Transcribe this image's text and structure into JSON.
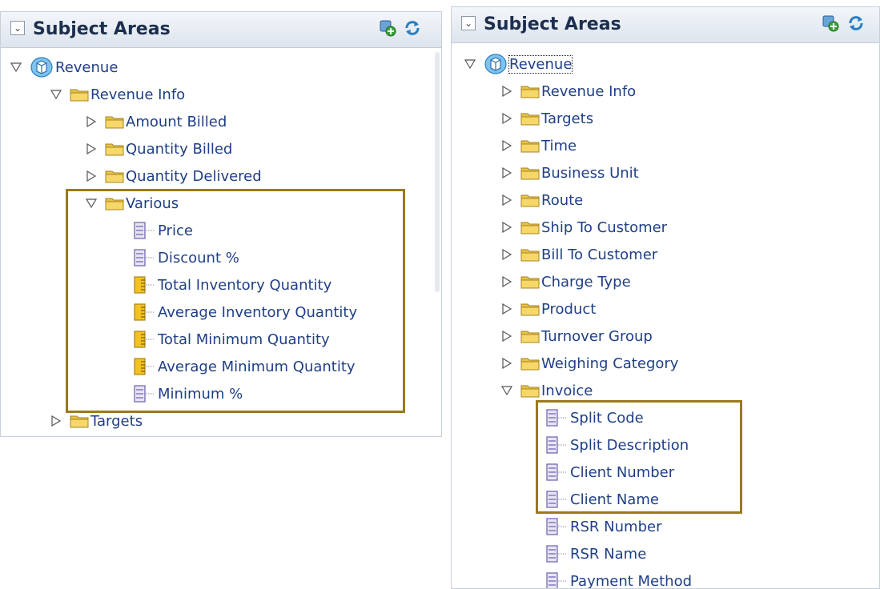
{
  "left_panel": {
    "title": "Subject Areas",
    "items": [
      {
        "label": "Revenue",
        "kind": "root",
        "expanded": true
      },
      {
        "label": "Revenue Info",
        "kind": "folder",
        "expanded": true
      },
      {
        "label": "Amount Billed",
        "kind": "folder",
        "expanded": false
      },
      {
        "label": "Quantity Billed",
        "kind": "folder",
        "expanded": false
      },
      {
        "label": "Quantity Delivered",
        "kind": "folder",
        "expanded": false
      },
      {
        "label": "Various",
        "kind": "folder",
        "expanded": true
      },
      {
        "label": "Price",
        "kind": "attribute"
      },
      {
        "label": "Discount %",
        "kind": "attribute"
      },
      {
        "label": "Total Inventory Quantity",
        "kind": "measure"
      },
      {
        "label": "Average Inventory Quantity",
        "kind": "measure"
      },
      {
        "label": "Total Minimum Quantity",
        "kind": "measure"
      },
      {
        "label": "Average Minimum Quantity",
        "kind": "measure"
      },
      {
        "label": "Minimum %",
        "kind": "attribute"
      },
      {
        "label": "Targets",
        "kind": "folder",
        "expanded": false
      }
    ]
  },
  "right_panel": {
    "title": "Subject Areas",
    "items": [
      {
        "label": "Revenue",
        "kind": "root",
        "expanded": true,
        "selected": true
      },
      {
        "label": "Revenue Info",
        "kind": "folder",
        "expanded": false
      },
      {
        "label": "Targets",
        "kind": "folder",
        "expanded": false
      },
      {
        "label": "Time",
        "kind": "folder",
        "expanded": false
      },
      {
        "label": "Business Unit",
        "kind": "folder",
        "expanded": false
      },
      {
        "label": "Route",
        "kind": "folder",
        "expanded": false
      },
      {
        "label": "Ship To Customer",
        "kind": "folder",
        "expanded": false
      },
      {
        "label": "Bill To Customer",
        "kind": "folder",
        "expanded": false
      },
      {
        "label": "Charge Type",
        "kind": "folder",
        "expanded": false
      },
      {
        "label": "Product",
        "kind": "folder",
        "expanded": false
      },
      {
        "label": "Turnover Group",
        "kind": "folder",
        "expanded": false
      },
      {
        "label": "Weighing Category",
        "kind": "folder",
        "expanded": false
      },
      {
        "label": "Invoice",
        "kind": "folder",
        "expanded": true
      },
      {
        "label": "Split Code",
        "kind": "attribute"
      },
      {
        "label": "Split Description",
        "kind": "attribute"
      },
      {
        "label": "Client Number",
        "kind": "attribute"
      },
      {
        "label": "Client Name",
        "kind": "attribute"
      },
      {
        "label": "RSR Number",
        "kind": "attribute"
      },
      {
        "label": "RSR Name",
        "kind": "attribute"
      },
      {
        "label": "Payment Method",
        "kind": "attribute"
      }
    ]
  },
  "colors": {
    "highlight_box": "#9a7a1e",
    "link_text": "#1f3f85",
    "header_text": "#1d2f4e"
  },
  "icons": [
    "collapse-toggle-icon",
    "add-subject-area-icon",
    "refresh-icon",
    "triangle-expanded-icon",
    "triangle-collapsed-icon",
    "folder-icon",
    "attribute-column-icon",
    "measure-column-icon",
    "subject-area-cube-icon"
  ]
}
